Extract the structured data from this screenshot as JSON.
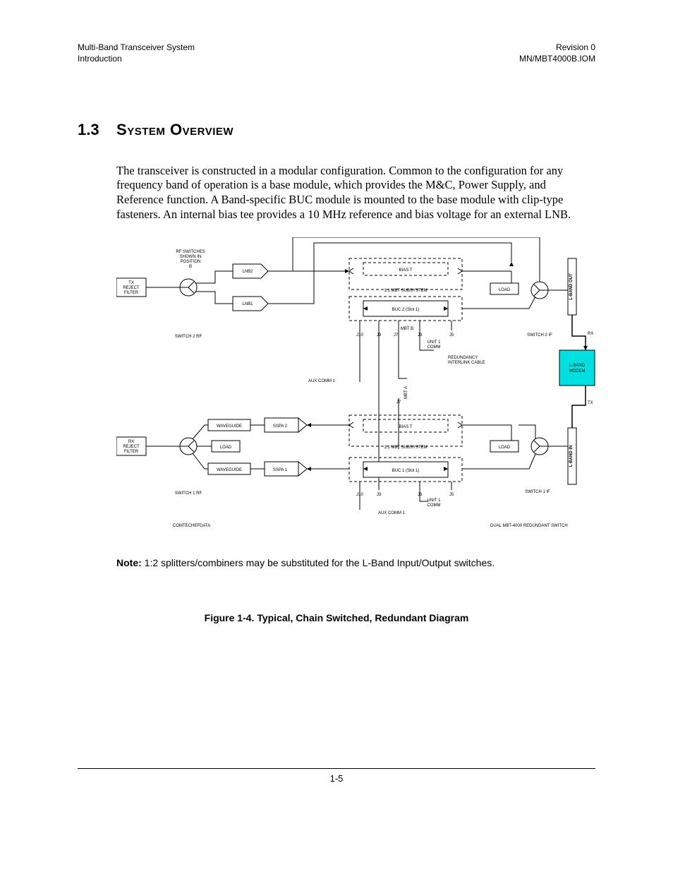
{
  "header": {
    "left_top": "Multi-Band Transceiver System",
    "left_bottom": "Introduction",
    "right_top": "Revision 0",
    "right_bottom": "MN/MBT4000B.IOM"
  },
  "section": {
    "number": "1.3",
    "title": "System Overview"
  },
  "paragraph": "The transceiver is constructed in a modular configuration. Common to the configuration for any frequency band of operation is a base module, which provides the M&C, Power Supply, and Reference function. A Band-specific BUC module is mounted to the base module with clip-type fasteners. An internal bias tee provides a 10 MHz reference and bias voltage for an external LNB.",
  "diagram": {
    "rf_switches_note_l1": "RF SWITCHES",
    "rf_switches_note_l2": "SHOWN IN",
    "rf_switches_note_l3": "POSITION",
    "rf_switches_note_l4": "B",
    "tx_reject_l1": "TX",
    "tx_reject_l2": "REJECT",
    "tx_reject_l3": "FILTER",
    "rx_reject_l1": "RX",
    "rx_reject_l2": "REJECT",
    "rx_reject_l3": "FILTER",
    "lnb1": "LNB1",
    "lnb2": "LNB2",
    "sspa1": "SSPA 1",
    "sspa2": "SSPA 2",
    "waveguide": "WAVEGUIDE",
    "switch2rf": "SWITCH 2 RF",
    "switch1rf": "SWITCH 1 RF",
    "switch2if": "SWITCH 2 IF",
    "switch1if": "SWITCH 1 IF",
    "biast": "BIAS T",
    "mbt_sub": "1:1 MBT SUBSYSTEM",
    "buc2": "BUC 2 (Slot 1)",
    "buc1": "BUC 1 (Slot 1)",
    "load": "LOAD",
    "j10": "J10",
    "j9": "J9",
    "j7": "J7",
    "j3": "J3",
    "j5": "J5",
    "mbt_b": "MBT B",
    "mbt_a": "MBT A",
    "unit_comm_l1": "UNIT 1",
    "unit_comm_l2": "COMM",
    "redundancy_l1": "REDUNDANCY",
    "redundancy_l2": "INTERLINK CABLE",
    "aux_comm": "AUX COMM 1",
    "lband_modem_l1": "L-BAND",
    "lband_modem_l2": "MODEM",
    "lband_out": "L-BAND OUT",
    "lband_in": "L-BAND IN",
    "rx": "RX",
    "tx": "TX",
    "comtech": "COMTECHEFDATA",
    "dual_mbt": "DUAL MBT-4000 REDUNDANT SWITCH"
  },
  "note": {
    "label": "Note:",
    "text": " 1:2 splitters/combiners may be substituted for the L-Band Input/Output switches."
  },
  "figure_caption": "Figure 1-4. Typical, Chain Switched, Redundant Diagram",
  "page_number": "1-5"
}
